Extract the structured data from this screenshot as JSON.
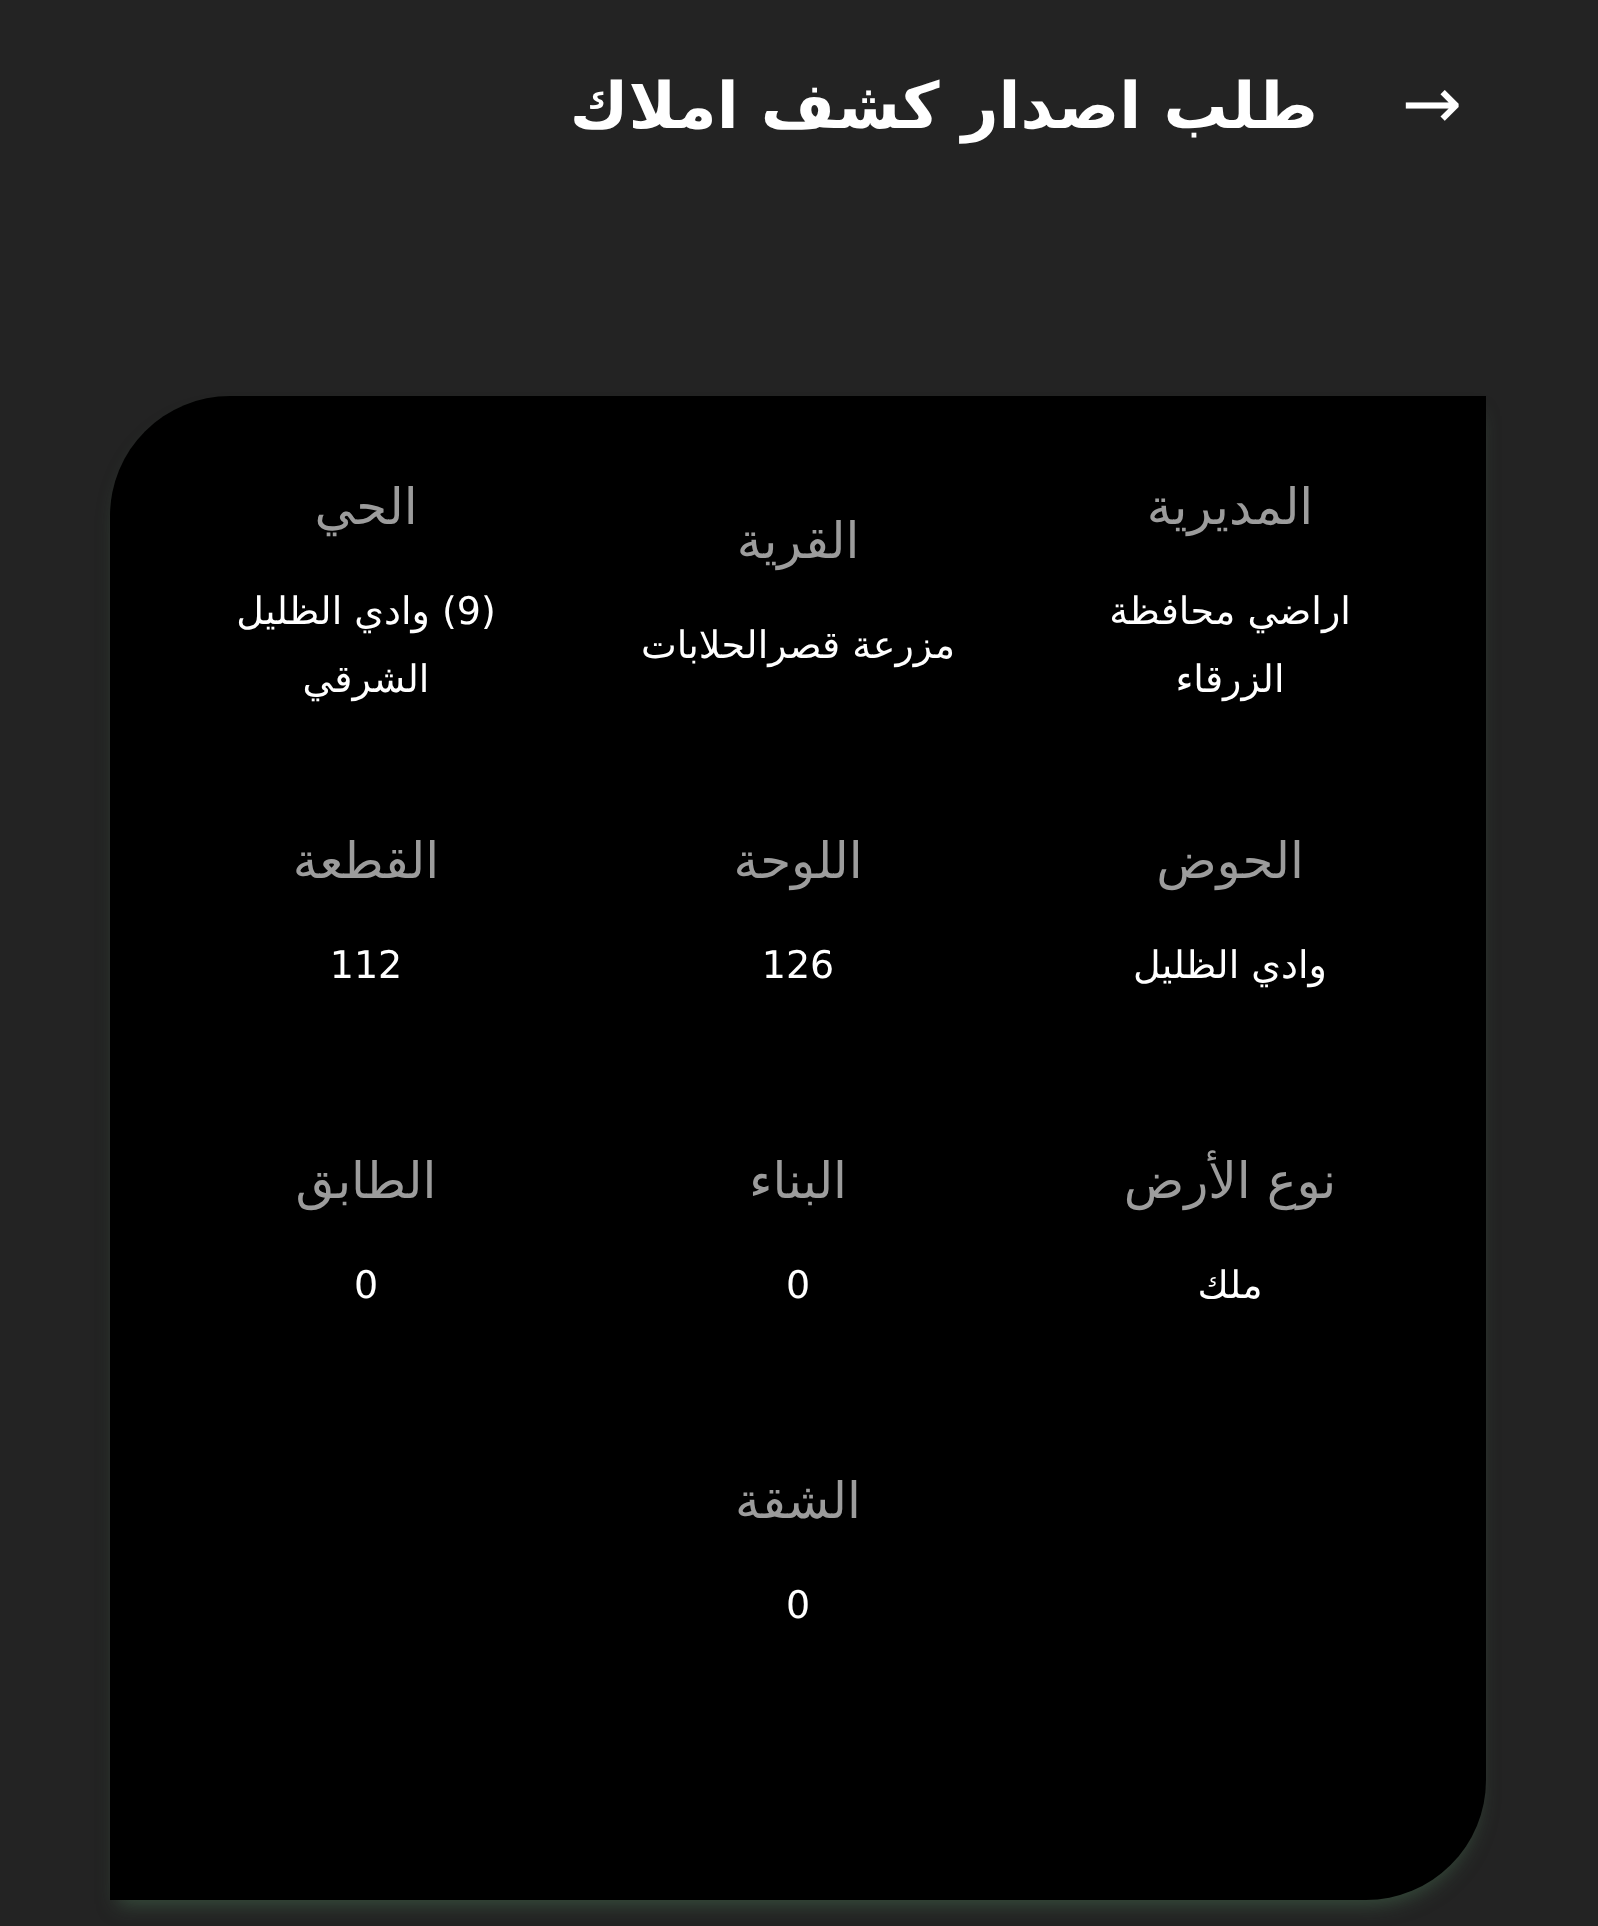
{
  "header": {
    "title": "طلب اصدار كشف املاك",
    "back_icon": "→"
  },
  "fields": [
    {
      "label": "المديرية",
      "value": "اراضي محافظة الزرقاء"
    },
    {
      "label": "القرية",
      "value": "مزرعة قصرالحلابات"
    },
    {
      "label": "الحي",
      "value": "(9) وادي الظليل الشرقي"
    },
    {
      "label": "الحوض",
      "value": "وادي الظليل"
    },
    {
      "label": "اللوحة",
      "value": "126"
    },
    {
      "label": "القطعة",
      "value": "112"
    },
    {
      "label": "نوع الأرض",
      "value": "ملك"
    },
    {
      "label": "البناء",
      "value": "0"
    },
    {
      "label": "الطابق",
      "value": "0"
    },
    {
      "label": "الشقة",
      "value": "0"
    }
  ]
}
